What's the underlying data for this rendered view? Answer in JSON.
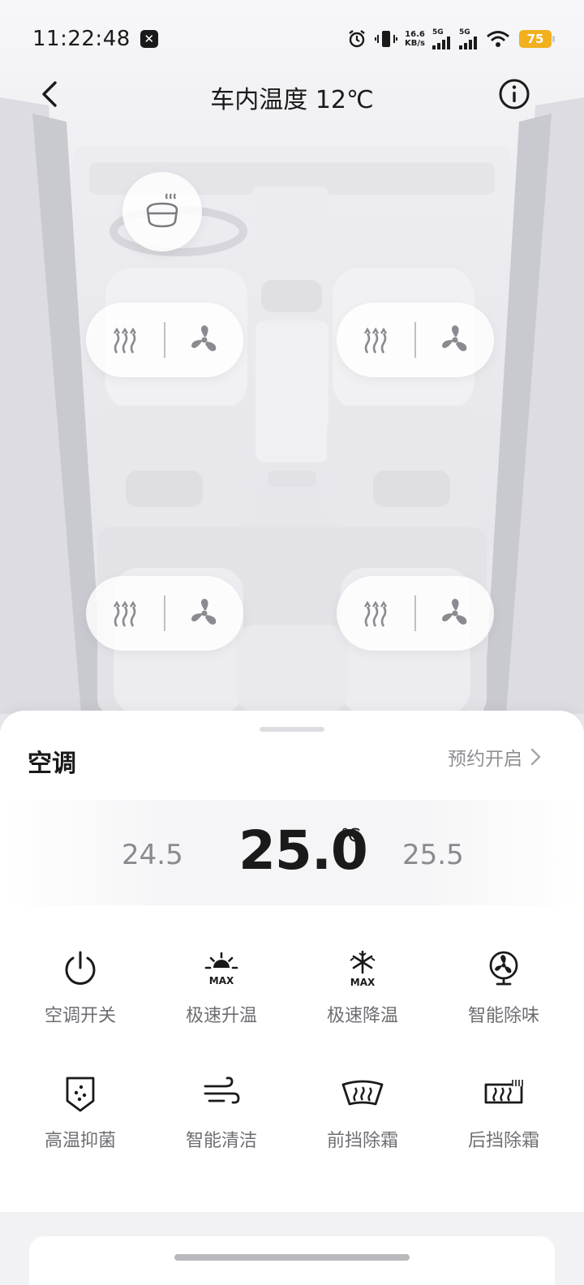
{
  "status_bar": {
    "time": "11:22:48",
    "app_icon": "✕",
    "network_speed_value": "16.6",
    "network_speed_unit": "KB/s",
    "signal1_label": "5G",
    "signal2_label": "5G",
    "battery": "75",
    "battery_color": "#f2b01e"
  },
  "header": {
    "title": "车内温度 12℃"
  },
  "sheet": {
    "title": "空调",
    "schedule_label": "预约开启"
  },
  "temperature": {
    "lower": "24.5",
    "current": "25.0",
    "unit": "℃",
    "higher": "25.5"
  },
  "functions": [
    {
      "label": "空调开关",
      "icon": "power-icon"
    },
    {
      "label": "极速升温",
      "icon": "sun-max-icon"
    },
    {
      "label": "极速降温",
      "icon": "snowflake-max-icon"
    },
    {
      "label": "智能除味",
      "icon": "fan-odor-icon"
    },
    {
      "label": "高温抑菌",
      "icon": "shield-dots-icon"
    },
    {
      "label": "智能清洁",
      "icon": "wind-icon"
    },
    {
      "label": "前挡除霜",
      "icon": "front-defrost-icon"
    },
    {
      "label": "后挡除霜",
      "icon": "rear-defrost-icon"
    }
  ]
}
